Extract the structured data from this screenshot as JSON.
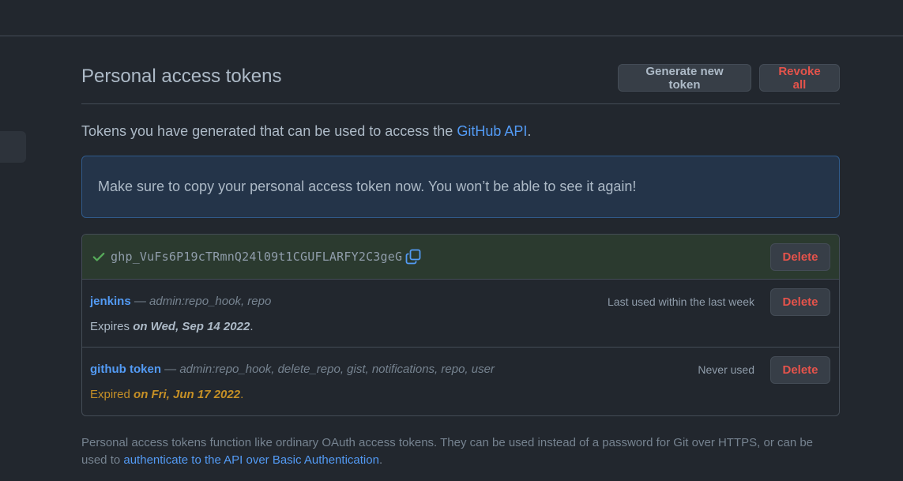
{
  "header": {
    "title": "Personal access tokens",
    "generate_label": "Generate new token",
    "revoke_label": "Revoke all"
  },
  "intro": {
    "text": "Tokens you have generated that can be used to access the ",
    "link": "GitHub API",
    "suffix": "."
  },
  "flash": {
    "message": "Make sure to copy your personal access token now. You won’t be able to see it again!"
  },
  "new_token": {
    "value": "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",
    "delete_label": "Delete",
    "icons": [
      "check-icon",
      "copy-icon"
    ]
  },
  "tokens": [
    {
      "name": "jenkins",
      "separator": " — ",
      "scopes": "admin:repo_hook, repo",
      "usage": "Last used within the last week",
      "expiry_prefix": "Expires ",
      "expiry_date": "on Wed, Sep 14 2022",
      "expiry_suffix": ".",
      "delete_label": "Delete"
    },
    {
      "name": "github token",
      "separator": " — ",
      "scopes": "admin:repo_hook, delete_repo, gist, notifications, repo, user",
      "usage": "Never used",
      "expiry_prefix": "Expired ",
      "expiry_date": "on Fri, Jun 17 2022",
      "expiry_suffix": ".",
      "delete_label": "Delete"
    }
  ],
  "footer": {
    "text": "Personal access tokens function like ordinary OAuth access tokens. They can be used instead of a password for Git over HTTPS, or can be used to ",
    "link": "authenticate to the API over Basic Authentication",
    "suffix": "."
  },
  "colors": {
    "background": "#22272e",
    "accent_link": "#539bf5",
    "danger": "#e5534b",
    "success": "#57ab5a",
    "warning": "#c69026",
    "flash_bg": "#243449"
  }
}
